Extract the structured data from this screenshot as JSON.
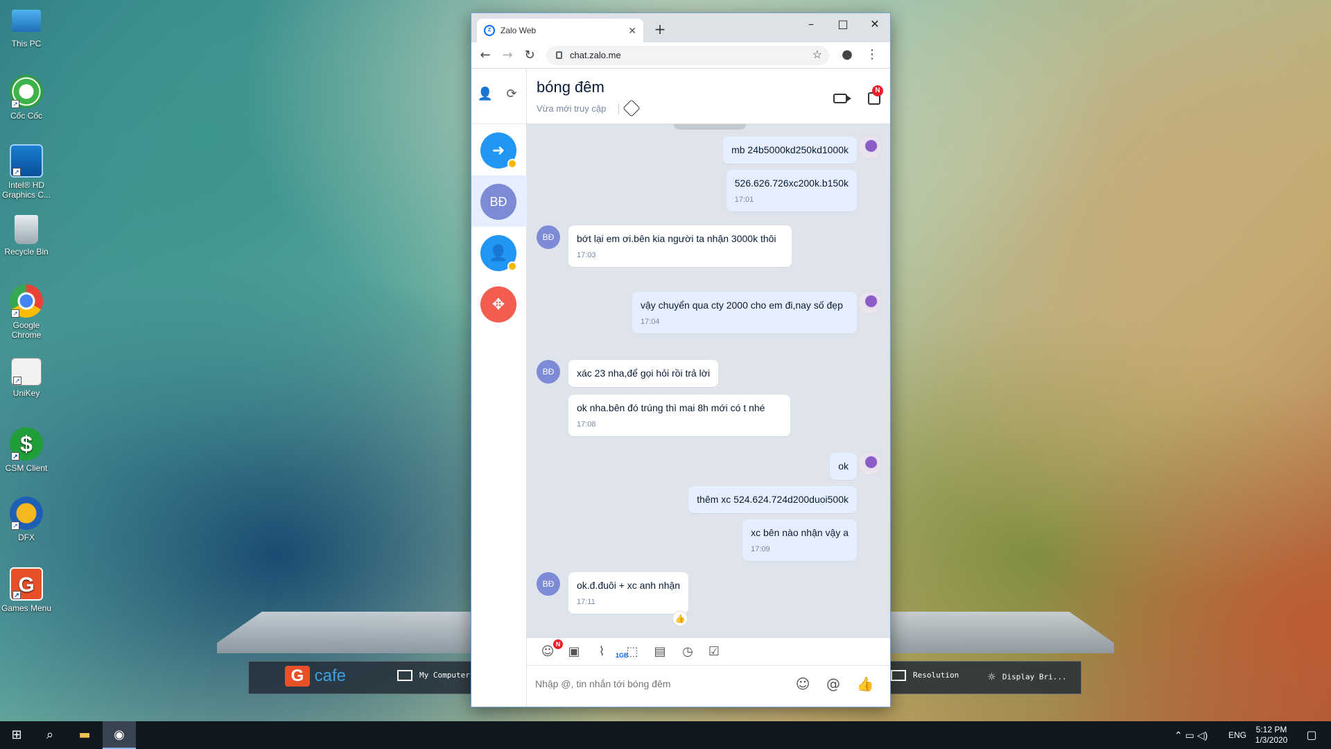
{
  "desktop": {
    "icons": [
      {
        "label": "This PC"
      },
      {
        "label": "Cốc Cốc"
      },
      {
        "label": "Intel® HD Graphics C..."
      },
      {
        "label": "Recycle Bin"
      },
      {
        "label": "Google Chrome"
      },
      {
        "label": "UniKey"
      },
      {
        "label": "CSM Client"
      },
      {
        "label": "DFX"
      },
      {
        "label": "Games Menu"
      }
    ],
    "dock": {
      "gcafe": "cafe",
      "mycomputer": "My Computer",
      "resolution": "Resolution",
      "display": "Display Bri..."
    }
  },
  "browser": {
    "tab_title": "Zalo Web",
    "url": "chat.zalo.me",
    "favicon_text": "Zalo"
  },
  "zalo": {
    "conversation": {
      "title": "bóng đêm",
      "status": "Vừa mới truy cập",
      "notif_badge": "N"
    },
    "sidebar_avatar_initials": "BĐ",
    "messages": [
      {
        "from": "me",
        "text": "mb 24b5000kd250kd1000k",
        "time": ""
      },
      {
        "from": "me",
        "text": "526.626.726xc200k.b150k",
        "time": "17:01"
      },
      {
        "from": "them",
        "text": "bớt lại em ơi.bên kia người ta nhận 3000k thôi",
        "time": "17:03"
      },
      {
        "from": "me",
        "text": "vậy chuyển qua cty 2000 cho em đi,nay số đẹp",
        "time": "17:04"
      },
      {
        "from": "them",
        "text": "xác 23 nha,để gọi hỏi rồi trả lời",
        "time": ""
      },
      {
        "from": "them",
        "text": "ok nha.bên đó trúng thì mai 8h mới có t  nhé",
        "time": "17:08"
      },
      {
        "from": "me",
        "text": "ok",
        "time": ""
      },
      {
        "from": "me",
        "text": "thêm xc 524.624.724d200duoi500k",
        "time": ""
      },
      {
        "from": "me",
        "text": "xc bên nào nhận vậy a",
        "time": "17:09"
      },
      {
        "from": "them",
        "text": "ok.đ.đuôi + xc anh nhận",
        "time": "17:11"
      }
    ],
    "composer": {
      "placeholder": "Nhập @, tin nhắn tới bóng đêm",
      "file_size_label": "1GB",
      "sticker_badge": "N",
      "mention_symbol": "@"
    }
  },
  "taskbar": {
    "language": "ENG",
    "time": "5:12 PM",
    "date": "1/3/2020"
  }
}
